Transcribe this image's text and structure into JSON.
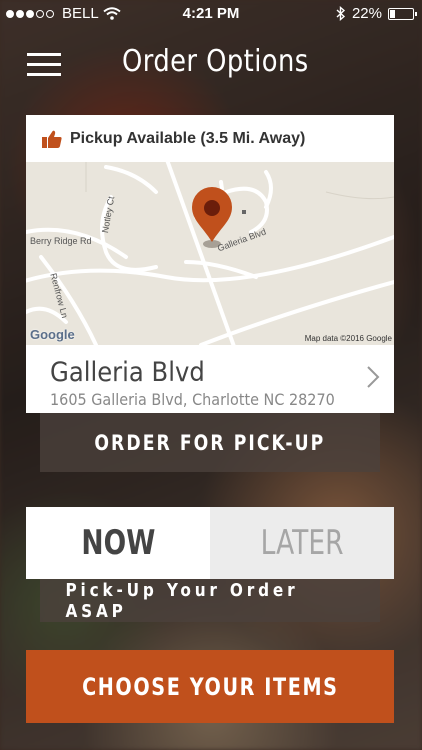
{
  "status_bar": {
    "carrier": "BELL",
    "time": "4:21 PM",
    "battery": "22%"
  },
  "header": {
    "title": "Order Options",
    "menu_icon": "hamburger-menu-icon"
  },
  "location_card": {
    "availability": "Pickup Available (3.5 Mi. Away)",
    "availability_icon": "thumbs-up-icon",
    "map": {
      "labels": {
        "berry_ridge": "Berry Ridge Rd",
        "notley": "Notley Ct",
        "renfrow": "Renfrow Ln",
        "galleria": "Galleria Blvd"
      },
      "attribution": "Map data ©2016 Google",
      "google_logo": "Google"
    },
    "store_name": "Galleria Blvd",
    "store_address": "1605 Galleria Blvd, Charlotte NC 28270"
  },
  "buttons": {
    "pickup": "ORDER FOR PICK-UP",
    "now": "NOW",
    "later": "LATER",
    "asap": "Pick-Up Your Order ASAP",
    "choose_items": "CHOOSE YOUR ITEMS"
  },
  "colors": {
    "accent": "#c0501c",
    "pin": "#c0501c"
  }
}
